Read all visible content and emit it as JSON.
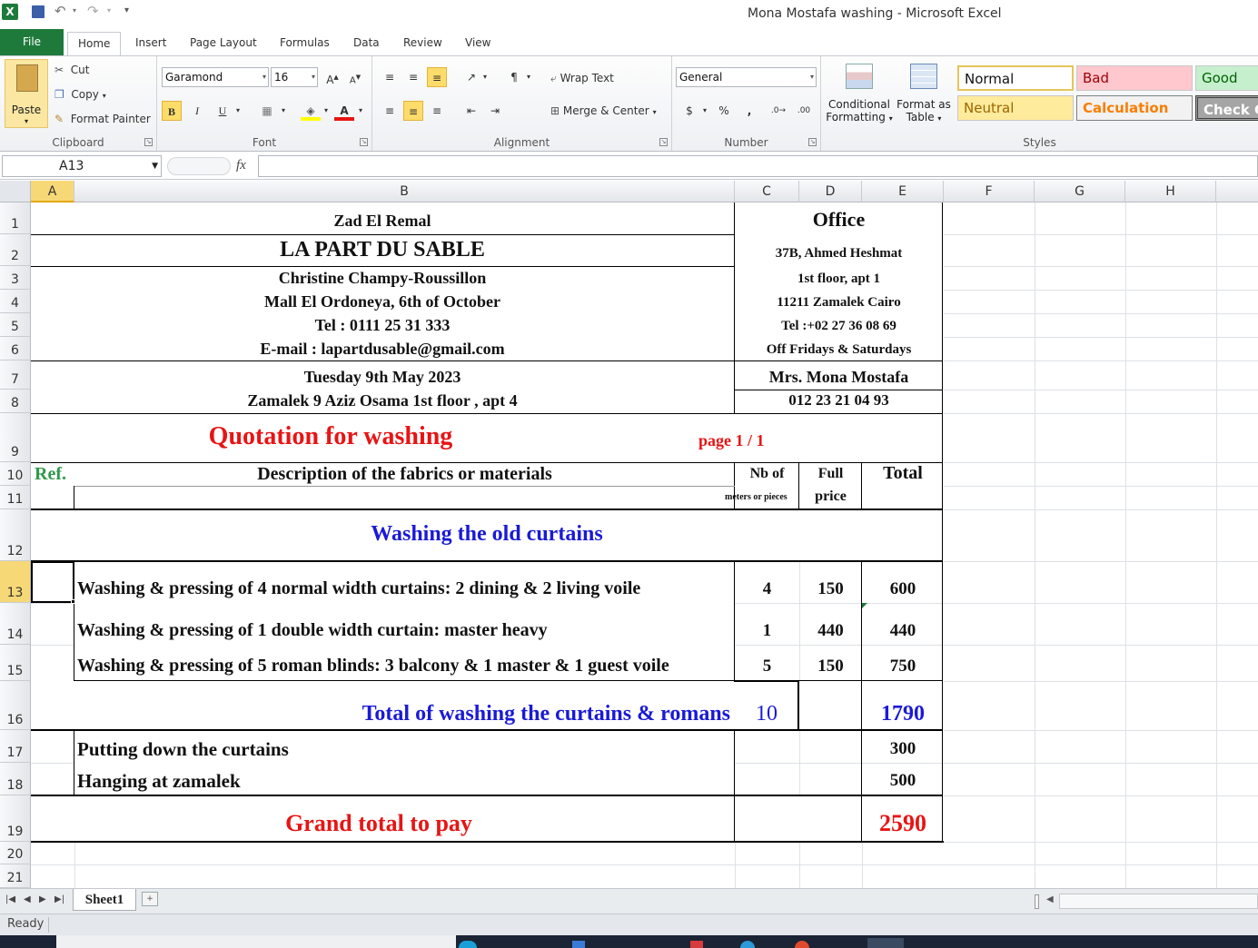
{
  "window": {
    "title": "Mona Mostafa washing  -  Microsoft Excel"
  },
  "ribbon": {
    "file_tab": "File",
    "tabs": [
      "Home",
      "Insert",
      "Page Layout",
      "Formulas",
      "Data",
      "Review",
      "View"
    ],
    "clipboard": {
      "paste": "Paste",
      "cut": "Cut",
      "copy": "Copy",
      "format_painter": "Format Painter",
      "label": "Clipboard"
    },
    "font": {
      "name": "Garamond",
      "size": "16",
      "bold": "B",
      "italic": "I",
      "underline": "U",
      "label": "Font"
    },
    "alignment": {
      "wrap_text": "Wrap Text",
      "merge_center": "Merge & Center",
      "label": "Alignment"
    },
    "number": {
      "format": "General",
      "currency": "$",
      "percent": "%",
      "comma": ",",
      "label": "Number"
    },
    "styles_group": {
      "conditional_formatting": [
        "Conditional",
        "Formatting"
      ],
      "format_as_table": [
        "Format as",
        "Table"
      ],
      "normal": "Normal",
      "bad": "Bad",
      "good": "Good",
      "neutral": "Neutral",
      "calculation": "Calculation",
      "check_cell": "Check Cell",
      "label": "Styles"
    }
  },
  "formula_bar": {
    "name_box": "A13",
    "fx": "fx",
    "value": ""
  },
  "columns": [
    "A",
    "B",
    "C",
    "D",
    "E",
    "F",
    "G",
    "H"
  ],
  "rows": [
    "1",
    "2",
    "3",
    "4",
    "5",
    "6",
    "7",
    "8",
    "9",
    "10",
    "11",
    "12",
    "13",
    "14",
    "15",
    "16",
    "17",
    "18",
    "19",
    "20",
    "21"
  ],
  "sheet": {
    "company": [
      "Zad El Remal",
      "LA PART DU SABLE",
      "Christine Champy-Roussillon",
      "Mall El Ordoneya, 6th of October",
      "Tel : 0111 25 31 333",
      "E-mail : lapartdusable@gmail.com"
    ],
    "office": [
      "Office",
      "37B, Ahmed Heshmat",
      "1st floor, apt 1",
      "11211 Zamalek  Cairo",
      "Tel :+02 27 36 08 69",
      "Off Fridays & Saturdays"
    ],
    "date": "Tuesday 9th May 2023",
    "client_address": "Zamalek 9 Aziz Osama 1st floor , apt 4",
    "client_name": "Mrs. Mona Mostafa",
    "client_phone": "012 23 21 04 93",
    "quotation_title": "Quotation for washing",
    "page": "page 1 / 1",
    "headers": {
      "ref": "Ref.",
      "description": "Description of the fabrics or materials",
      "nb_of": "Nb of",
      "meters": "meters or pieces",
      "full": "Full",
      "price": "price",
      "total": "Total"
    },
    "section_title": "Washing the old curtains",
    "items": [
      {
        "desc": "Washing & pressing of 4 normal width curtains: 2 dining & 2 living voile",
        "qty": "4",
        "price": "150",
        "total": "600"
      },
      {
        "desc": "Washing & pressing of 1  double width curtain: master heavy",
        "qty": "1",
        "price": "440",
        "total": "440"
      },
      {
        "desc": "Washing & pressing of 5 roman blinds: 3 balcony & 1 master & 1 guest voile",
        "qty": "5",
        "price": "150",
        "total": "750"
      }
    ],
    "subtotal": {
      "label": "Total of washing the curtains & romans",
      "qty": "10",
      "total": "1790"
    },
    "extras": [
      {
        "desc": "Putting down the curtains",
        "total": "300"
      },
      {
        "desc": "Hanging at zamalek",
        "total": "500"
      }
    ],
    "grand_total": {
      "label": "Grand total to pay",
      "value": "2590"
    }
  },
  "sheet_tab": "Sheet1",
  "status": "Ready",
  "colors": {
    "red": "#e81414",
    "blue": "#1a1ad6",
    "green_ref": "#2f9a4a",
    "file_green": "#1e7a3a"
  }
}
